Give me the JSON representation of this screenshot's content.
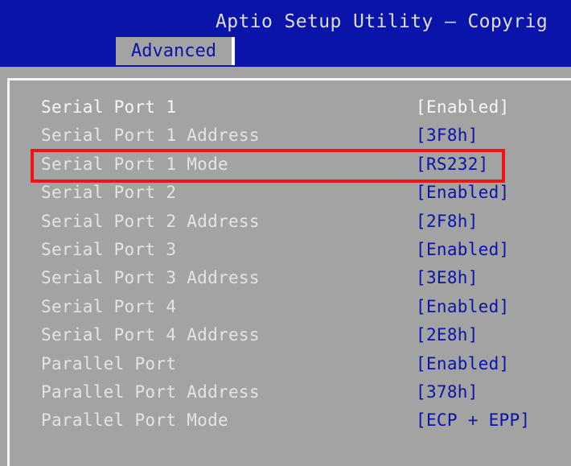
{
  "header": {
    "title": "Aptio Setup Utility – Copyrig",
    "active_tab": "Advanced"
  },
  "settings": [
    {
      "label": "Serial Port 1",
      "value": "[Enabled]"
    },
    {
      "label": "Serial Port 1 Address",
      "value": "[3F8h]"
    },
    {
      "label": "Serial Port 1 Mode",
      "value": "[RS232]"
    },
    {
      "label": "Serial Port 2",
      "value": "[Enabled]"
    },
    {
      "label": "Serial Port 2 Address",
      "value": "[2F8h]"
    },
    {
      "label": "Serial Port 3",
      "value": "[Enabled]"
    },
    {
      "label": "Serial Port 3 Address",
      "value": "[3E8h]"
    },
    {
      "label": "Serial Port 4",
      "value": "[Enabled]"
    },
    {
      "label": "Serial Port 4 Address",
      "value": "[2E8h]"
    },
    {
      "label": "Parallel Port",
      "value": "[Enabled]"
    },
    {
      "label": "Parallel Port Address",
      "value": "[378h]"
    },
    {
      "label": "Parallel Port Mode",
      "value": "[ECP + EPP]"
    }
  ],
  "colors": {
    "bios_blue": "#0a14a8",
    "panel_gray": "#a3a3a3",
    "highlight_red": "#f01414"
  }
}
